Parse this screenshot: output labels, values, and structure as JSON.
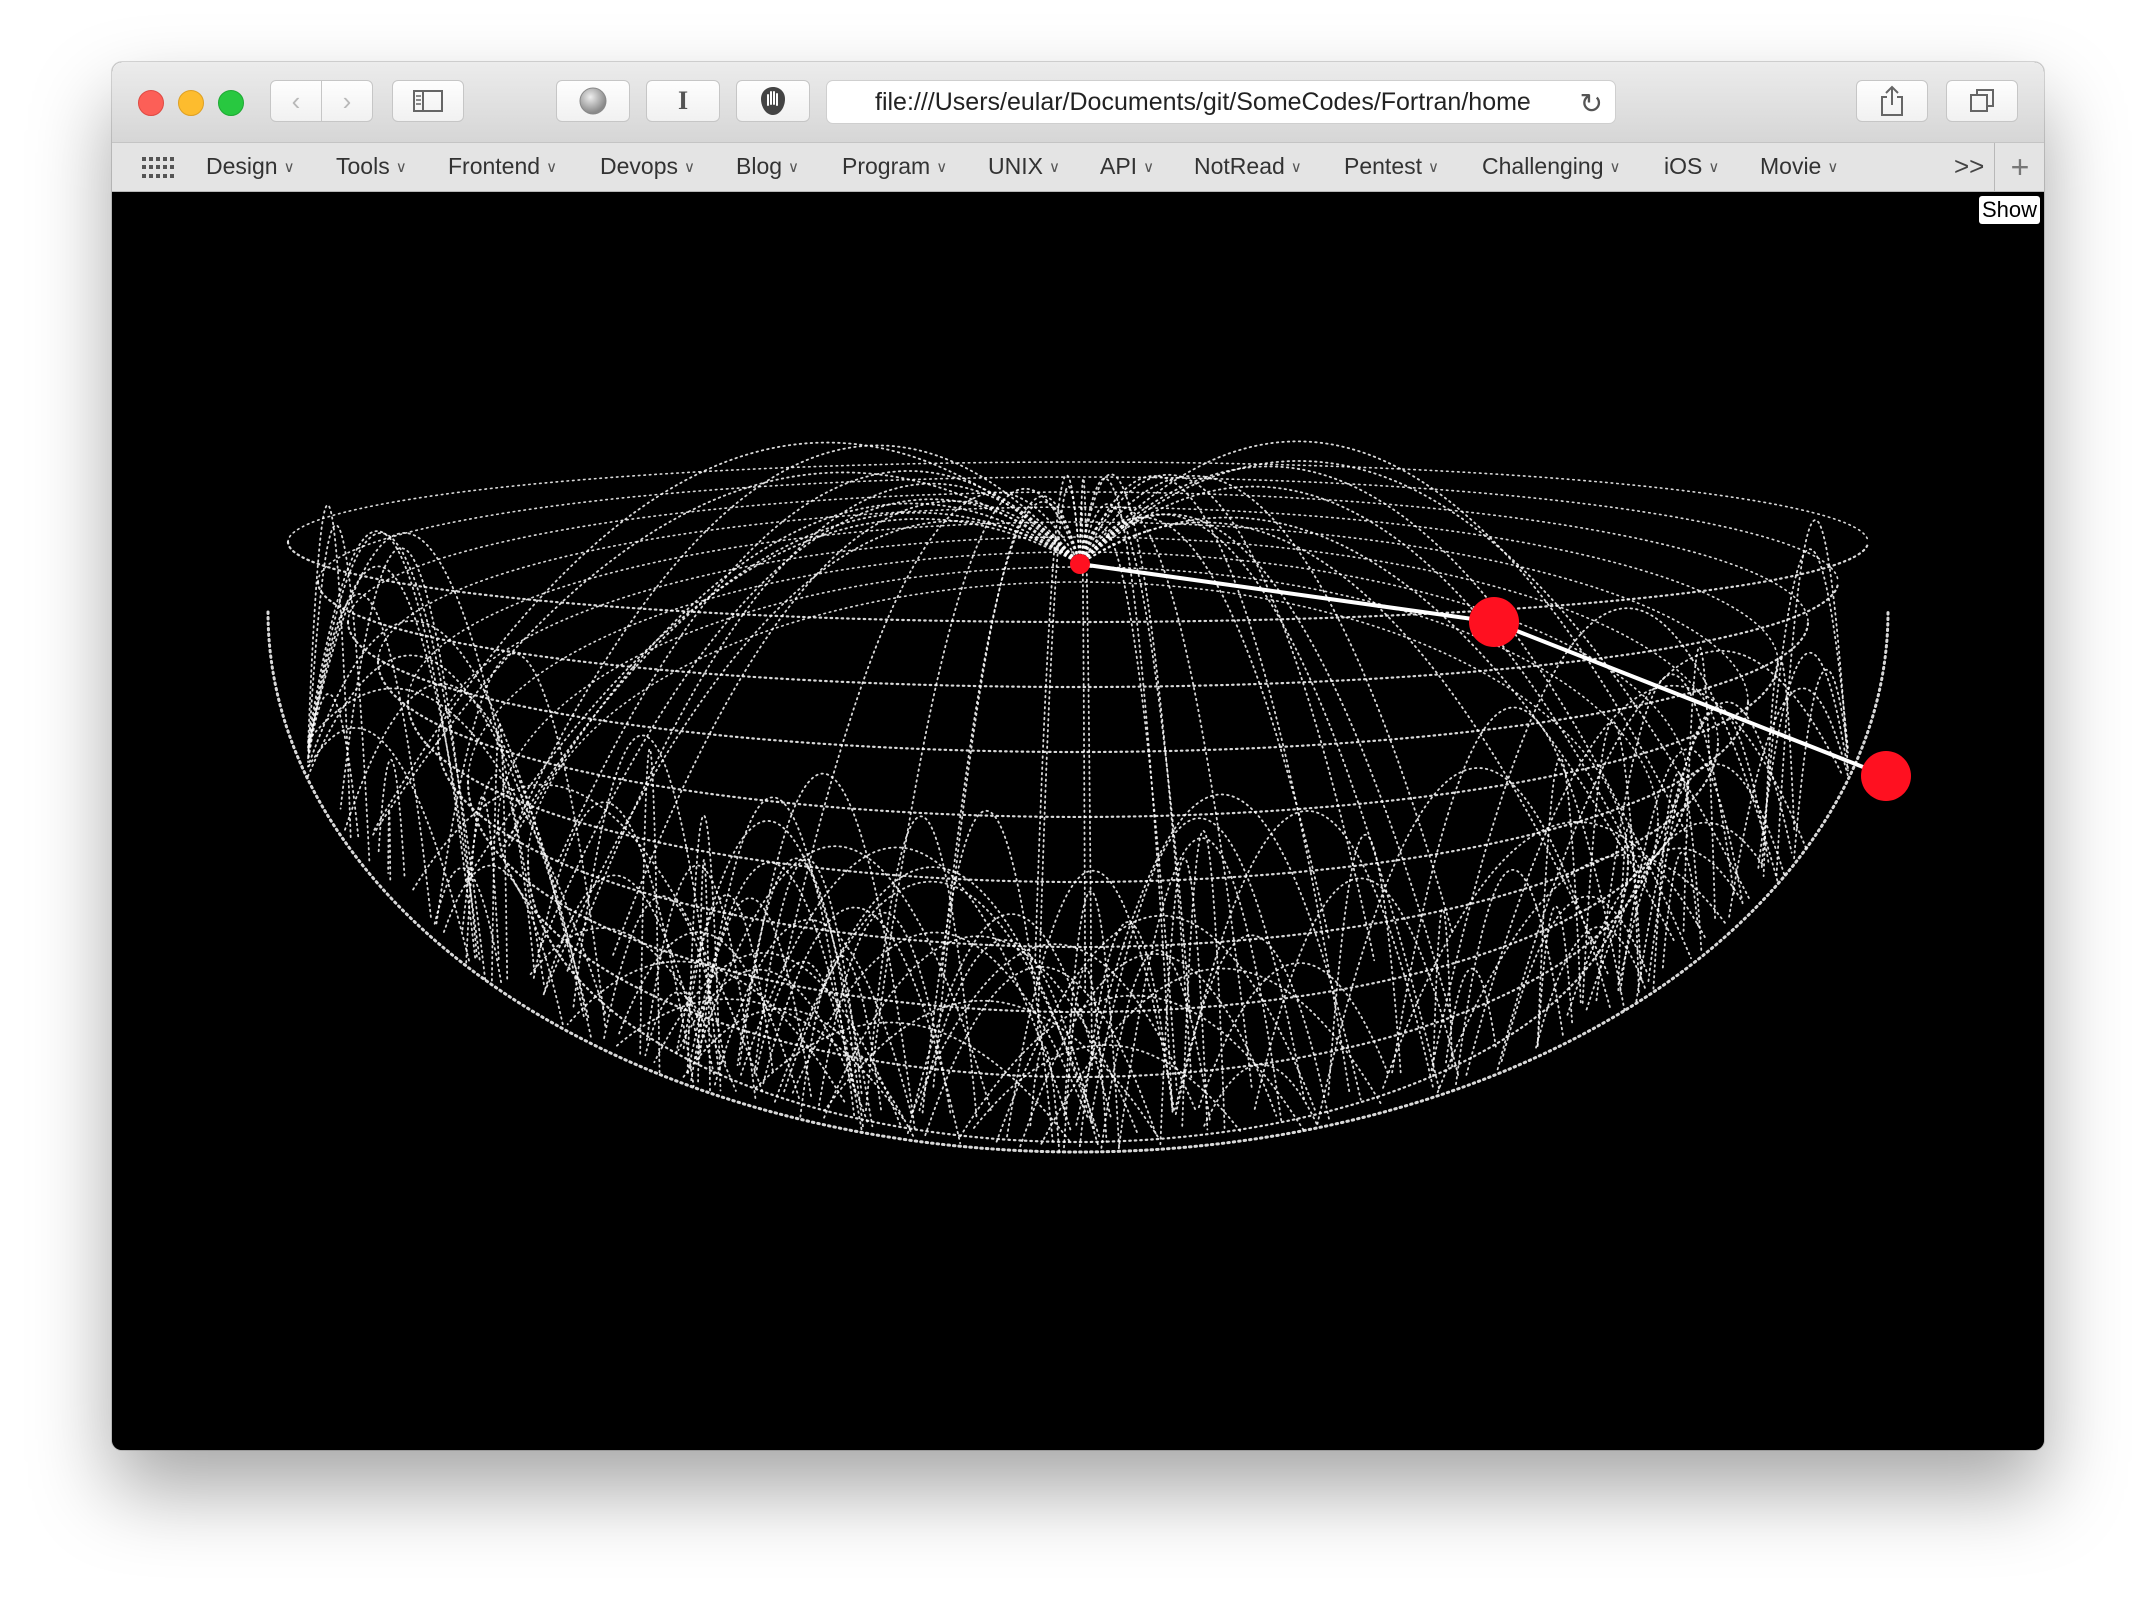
{
  "browser": {
    "url": "file:///Users/eular/Documents/git/SomeCodes/Fortran/home",
    "icons": {
      "back": "chevron-left-icon",
      "forward": "chevron-right-icon",
      "sidebar": "sidebar-icon",
      "reload": "reload-icon",
      "share": "share-icon",
      "tabs": "tabs-icon"
    }
  },
  "bookmarks": {
    "items": [
      {
        "label": "Design"
      },
      {
        "label": "Tools"
      },
      {
        "label": "Frontend"
      },
      {
        "label": "Devops"
      },
      {
        "label": "Blog"
      },
      {
        "label": "Program"
      },
      {
        "label": "UNIX"
      },
      {
        "label": "API"
      },
      {
        "label": "NotRead"
      },
      {
        "label": "Pentest"
      },
      {
        "label": "Challenging"
      },
      {
        "label": "iOS"
      },
      {
        "label": "Movie"
      }
    ],
    "overflow_label": ">>",
    "add_label": "+"
  },
  "page": {
    "show_button": "Show",
    "colors": {
      "background": "#000000",
      "trails": "#ffffff",
      "balls": "#ff1020"
    }
  }
}
